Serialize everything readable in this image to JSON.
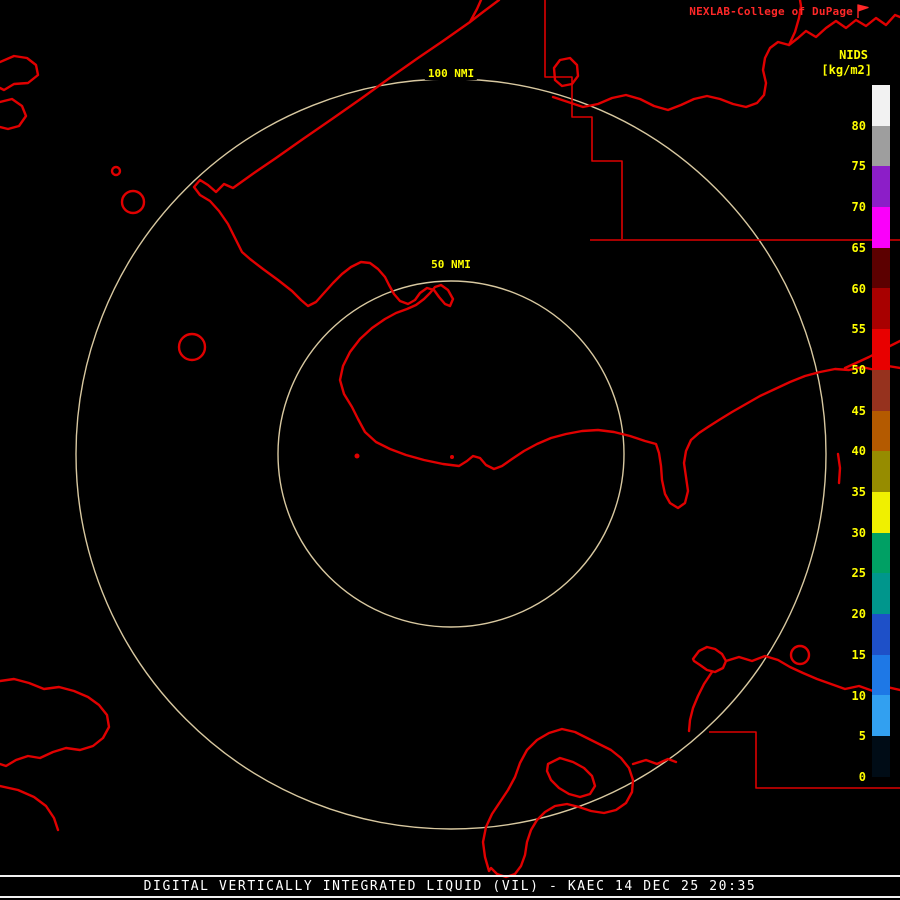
{
  "header": {
    "title": "NEXLAB-College of DuPage"
  },
  "scale": {
    "name": "NIDS",
    "units": "[kg/m2]",
    "ticks": [
      "80",
      "75",
      "70",
      "65",
      "60",
      "55",
      "50",
      "45",
      "40",
      "35",
      "30",
      "25",
      "20",
      "15",
      "10",
      "5",
      "0"
    ],
    "segments": [
      {
        "range": "above-80",
        "color": "#f2f2f2"
      },
      {
        "range": "75-80",
        "color": "#9e9e9e"
      },
      {
        "range": "70-75",
        "color": "#8c1ec8"
      },
      {
        "range": "65-70",
        "color": "#fa00fa"
      },
      {
        "range": "60-65",
        "color": "#5c0000"
      },
      {
        "range": "55-60",
        "color": "#a80000"
      },
      {
        "range": "50-55",
        "color": "#e80000"
      },
      {
        "range": "45-50",
        "color": "#96321e"
      },
      {
        "range": "40-45",
        "color": "#b45a00"
      },
      {
        "range": "35-40",
        "color": "#968c00"
      },
      {
        "range": "30-35",
        "color": "#f0f000"
      },
      {
        "range": "25-30",
        "color": "#00a064"
      },
      {
        "range": "20-25",
        "color": "#00968c"
      },
      {
        "range": "15-20",
        "color": "#1e50c8"
      },
      {
        "range": "10-15",
        "color": "#1e78e6"
      },
      {
        "range": "5-10",
        "color": "#32a0f0"
      },
      {
        "range": "0-5",
        "color": "#000c16"
      }
    ]
  },
  "range_rings": [
    {
      "label": "50 NMI"
    },
    {
      "label": "100 NMI"
    }
  ],
  "footer": {
    "text": "DIGITAL VERTICALLY INTEGRATED LIQUID (VIL) - KAEC 14 DEC 25 20:35"
  },
  "colors": {
    "background": "#000000",
    "map_outline": "#e00000",
    "boundary_line": "#dd0000",
    "range_ring": "#d8c8a0",
    "scale_text": "#ffff00",
    "title_text": "#ff2828",
    "footer_text": "#ffffff"
  }
}
